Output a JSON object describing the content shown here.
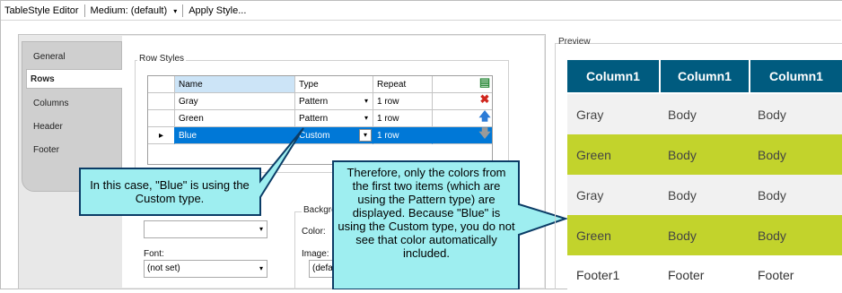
{
  "toolbar": {
    "title": "TableStyle Editor",
    "medium": "Medium: (default)",
    "apply": "Apply Style..."
  },
  "tabs": [
    "General",
    "Rows",
    "Columns",
    "Header",
    "Footer"
  ],
  "active_tab": "Rows",
  "row_styles": {
    "group_label": "Row Styles",
    "columns": [
      "",
      "Name",
      "Type",
      "Repeat",
      ""
    ],
    "rows": [
      {
        "name": "Gray",
        "type": "Pattern",
        "repeat": "1 row",
        "selected": false
      },
      {
        "name": "Green",
        "type": "Pattern",
        "repeat": "1 row",
        "selected": false
      },
      {
        "name": "Blue",
        "type": "Custom",
        "repeat": "1 row",
        "selected": true
      }
    ],
    "icons": [
      "add-icon",
      "delete-icon",
      "move-up-icon",
      "move-down-icon"
    ]
  },
  "form": {
    "background_label": "Backgrou",
    "color_label": "Color:",
    "image_label": "Image:",
    "image_value": "(defau",
    "font_label": "Font:",
    "font_value": "(not set)"
  },
  "callouts": {
    "left": "In this case, \"Blue\" is using the Custom type.",
    "right": "Therefore, only the colors from the first two items (which are using the Pattern type) are displayed. Because \"Blue\" is using the Custom type, you do not see that color automatically included."
  },
  "preview": {
    "label": "Preview",
    "header": [
      "Column1",
      "Column1",
      "Column1"
    ],
    "rows": [
      {
        "cells": [
          "Gray",
          "Body",
          "Body"
        ],
        "style": "gray"
      },
      {
        "cells": [
          "Green",
          "Body",
          "Body"
        ],
        "style": "green"
      },
      {
        "cells": [
          "Gray",
          "Body",
          "Body"
        ],
        "style": "gray"
      },
      {
        "cells": [
          "Green",
          "Body",
          "Body"
        ],
        "style": "green"
      },
      {
        "cells": [
          "Footer1",
          "Footer",
          "Footer"
        ],
        "style": "footer"
      }
    ]
  },
  "colors": {
    "preview_header": "#005b7f",
    "preview_green": "#c2d32c",
    "preview_gray": "#f1f1f1",
    "selection": "#0078d7",
    "callout_fill": "#9eeef0"
  }
}
